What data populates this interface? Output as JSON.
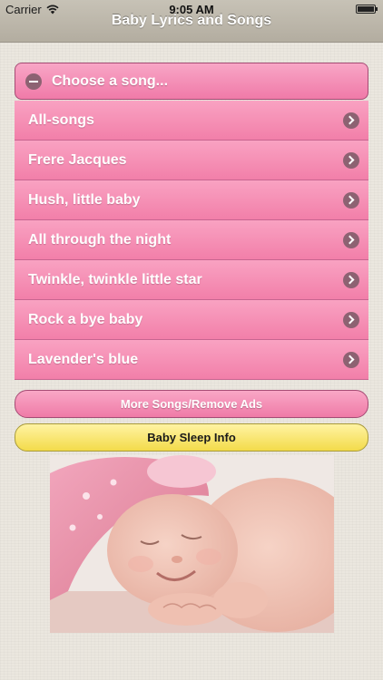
{
  "status_bar": {
    "carrier": "Carrier",
    "time": "9:05 AM",
    "wifi_icon": "wifi-icon",
    "battery_icon": "battery-icon"
  },
  "nav": {
    "title": "Baby Lyrics and Songs"
  },
  "header": {
    "label": "Choose a song...",
    "icon": "minus-circle-icon"
  },
  "songs": [
    "All-songs",
    "Frere Jacques",
    "Hush, little baby",
    "All through the night",
    "Twinkle, twinkle little star",
    "Rock a bye baby",
    "Lavender's blue"
  ],
  "buttons": {
    "more": "More Songs/Remove Ads",
    "sleep": "Baby Sleep Info"
  },
  "colors": {
    "accent_pink": "#f48ab1",
    "accent_yellow": "#f6e066",
    "icon_circle": "#8d6272"
  },
  "photo": {
    "subject": "sleeping-baby-photo"
  }
}
